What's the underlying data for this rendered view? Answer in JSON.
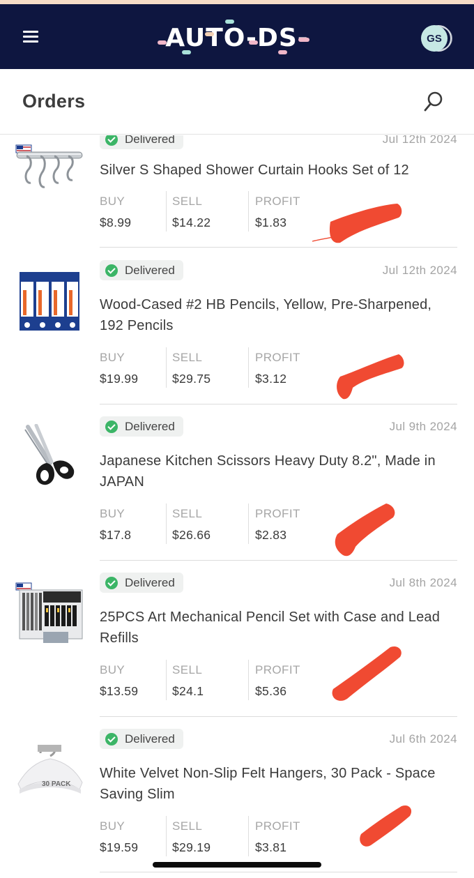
{
  "app": {
    "logo_text": "AUTO-DS-",
    "brand_colors": {
      "navy": "#0e1640",
      "pink": "#f0b6c8",
      "mint": "#a9e1d9",
      "peach": "#f3d0b4"
    },
    "user_initials": "GS"
  },
  "page": {
    "title": "Orders"
  },
  "labels": {
    "buy": "BUY",
    "sell": "SELL",
    "profit": "PROFIT"
  },
  "orders": [
    {
      "status": "Delivered",
      "date": "Jul 12th 2024",
      "title": "Silver S Shaped Shower Curtain Hooks Set of 12",
      "buy": "$8.99",
      "sell": "$14.22",
      "profit": "$1.83",
      "image": "shower-hooks"
    },
    {
      "status": "Delivered",
      "date": "Jul 12th 2024",
      "title": "Wood-Cased #2 HB Pencils, Yellow, Pre-Sharpened, 192 Pencils",
      "buy": "$19.99",
      "sell": "$29.75",
      "profit": "$3.12",
      "image": "pencil-boxes"
    },
    {
      "status": "Delivered",
      "date": "Jul 9th 2024",
      "title": "Japanese Kitchen Scissors Heavy Duty 8.2\", Made in JAPAN",
      "buy": "$17.8",
      "sell": "$26.66",
      "profit": "$2.83",
      "image": "scissors"
    },
    {
      "status": "Delivered",
      "date": "Jul 8th 2024",
      "title": "25PCS Art Mechanical Pencil Set with Case and Lead Refills",
      "buy": "$13.59",
      "sell": "$24.1",
      "profit": "$5.36",
      "image": "mechanical-pencil-set"
    },
    {
      "status": "Delivered",
      "date": "Jul 6th 2024",
      "title": "White Velvet Non-Slip Felt Hangers, 30 Pack - Space Saving Slim",
      "buy": "$19.59",
      "sell": "$29.19",
      "profit": "$3.81",
      "image": "hangers",
      "image_text": "30 PACK"
    }
  ],
  "redaction_color": "#f04a32"
}
